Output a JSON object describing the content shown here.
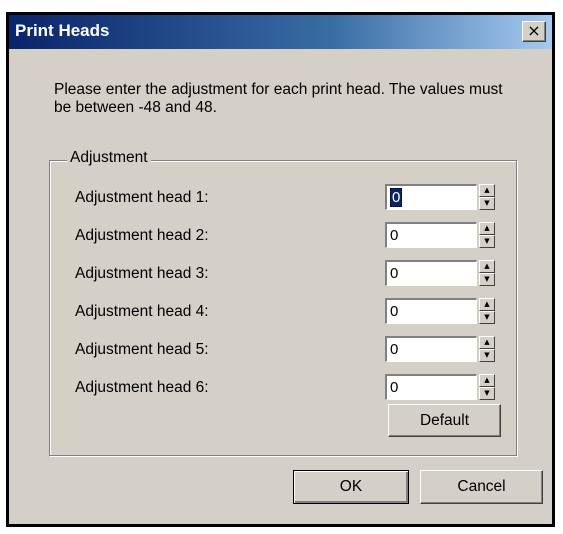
{
  "window": {
    "title": "Print Heads",
    "close_label": "×"
  },
  "instructions": "Please enter the adjustment for each print head. The values must be between -48 and 48.",
  "group": {
    "label": "Adjustment",
    "rows": [
      {
        "label": "Adjustment head 1:",
        "value": "0"
      },
      {
        "label": "Adjustment head 2:",
        "value": "0"
      },
      {
        "label": "Adjustment head 3:",
        "value": "0"
      },
      {
        "label": "Adjustment head 4:",
        "value": "0"
      },
      {
        "label": "Adjustment head 5:",
        "value": "0"
      },
      {
        "label": "Adjustment head 6:",
        "value": "0"
      }
    ],
    "default_label": "Default"
  },
  "buttons": {
    "ok_label": "OK",
    "cancel_label": "Cancel"
  },
  "colors": {
    "titlebar_start": "#0a246a",
    "titlebar_end": "#a6caf0",
    "dialog_bg": "#d4d0c8"
  }
}
